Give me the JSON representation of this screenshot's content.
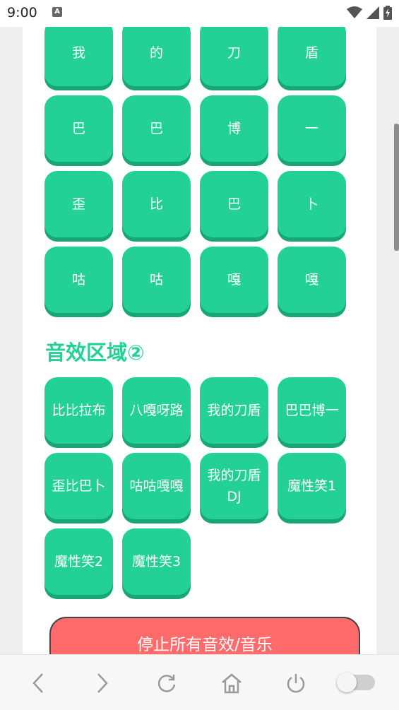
{
  "status_bar": {
    "time": "9:00",
    "notification_icon": "A",
    "icons": [
      "wifi-icon",
      "cell-signal-icon",
      "battery-charging-icon"
    ]
  },
  "grid1": {
    "buttons": [
      "我",
      "的",
      "刀",
      "盾",
      "巴",
      "巴",
      "博",
      "一",
      "歪",
      "比",
      "巴",
      "卜",
      "咕",
      "咕",
      "嘎",
      "嘎"
    ]
  },
  "section2": {
    "title": "音效区域②"
  },
  "grid2": {
    "buttons": [
      "比比拉布",
      "八嘎呀路",
      "我的刀盾",
      "巴巴博一",
      "歪比巴卜",
      "咕咕嘎嘎",
      "我的刀盾DJ",
      "魔性笑1",
      "魔性笑2",
      "魔性笑3"
    ]
  },
  "stop_button": {
    "label": "停止所有音效/音乐"
  },
  "colors": {
    "accent": "#23d196",
    "accent_shadow": "#19a676",
    "stop": "#ff6b6b"
  },
  "nav": {
    "icons": [
      "back-icon",
      "forward-icon",
      "reload-icon",
      "home-icon",
      "power-icon",
      "toggle-switch"
    ]
  }
}
